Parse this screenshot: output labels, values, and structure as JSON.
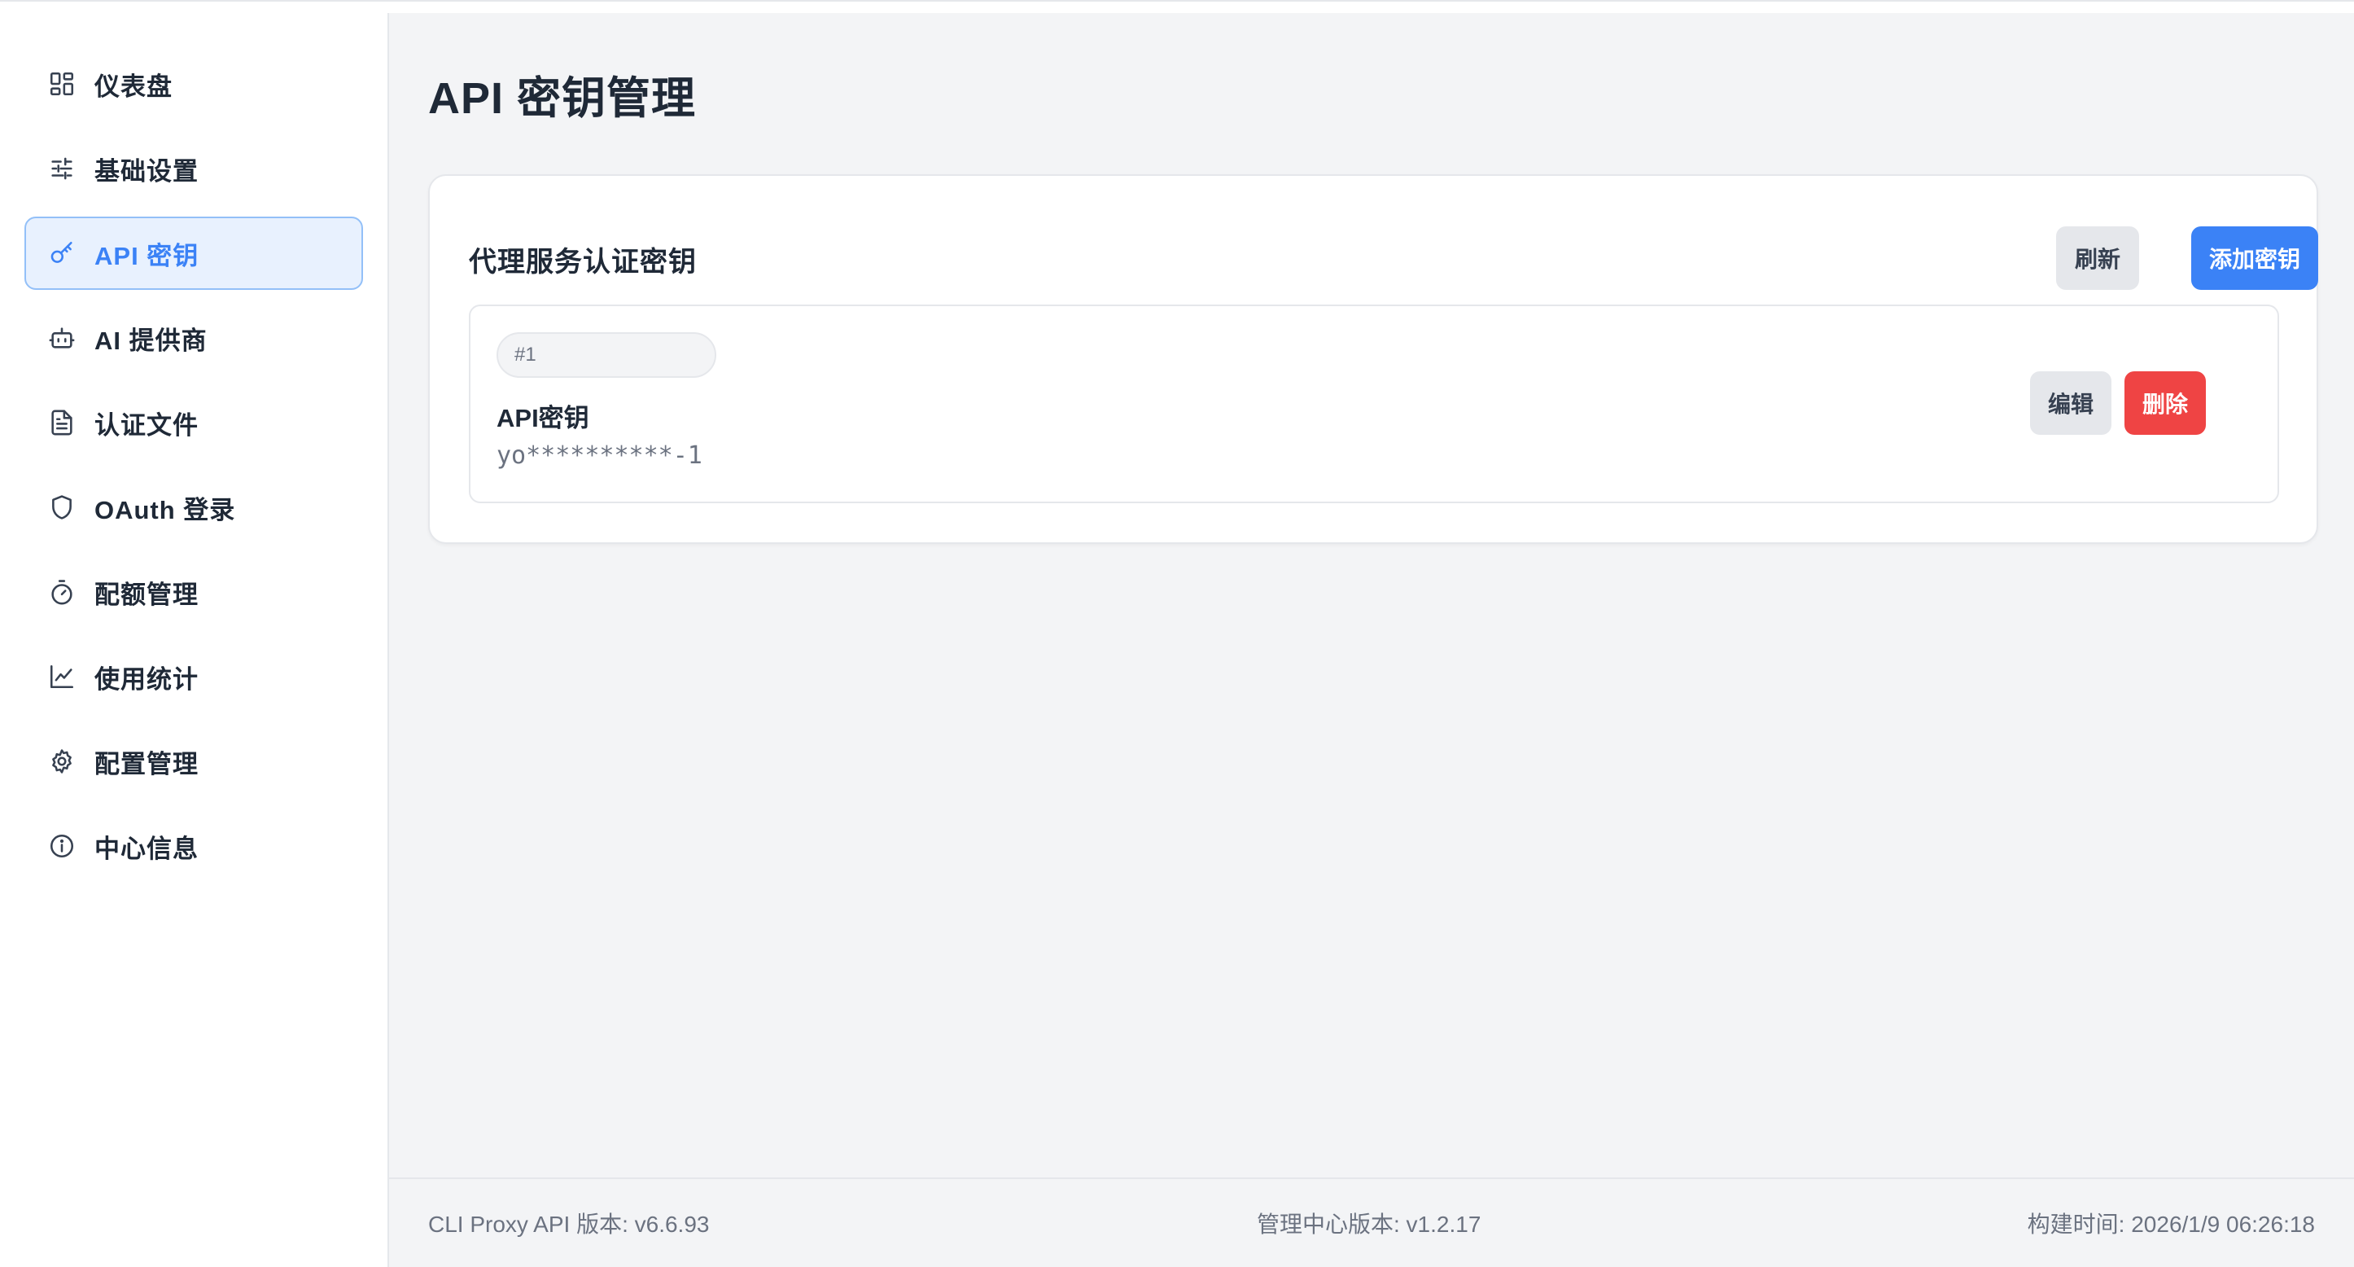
{
  "sidebar": {
    "items": [
      {
        "label": "仪表盘",
        "icon": "dashboard-grid-icon"
      },
      {
        "label": "基础设置",
        "icon": "sliders-icon"
      },
      {
        "label": "API 密钥",
        "icon": "key-icon",
        "active": true
      },
      {
        "label": "AI 提供商",
        "icon": "bot-icon"
      },
      {
        "label": "认证文件",
        "icon": "file-text-icon"
      },
      {
        "label": "OAuth 登录",
        "icon": "shield-icon"
      },
      {
        "label": "配额管理",
        "icon": "timer-icon"
      },
      {
        "label": "使用统计",
        "icon": "line-chart-icon"
      },
      {
        "label": "配置管理",
        "icon": "gear-icon"
      },
      {
        "label": "中心信息",
        "icon": "info-icon"
      }
    ]
  },
  "main": {
    "title": "API 密钥管理",
    "card": {
      "title": "代理服务认证密钥",
      "refresh_label": "刷新",
      "add_label": "添加密钥",
      "keys": [
        {
          "badge": "#1",
          "name": "API密钥",
          "value": "yo**********-1",
          "edit_label": "编辑",
          "delete_label": "删除"
        }
      ]
    }
  },
  "footer": {
    "cli_version": "CLI Proxy API 版本: v6.6.93",
    "center_version": "管理中心版本: v1.2.17",
    "build_time": "构建时间: 2026/1/9 06:26:18"
  },
  "colors": {
    "accent": "#3b82f6",
    "danger": "#ef4444",
    "active_bg": "#e8f1fe",
    "main_bg": "#f3f4f6"
  }
}
